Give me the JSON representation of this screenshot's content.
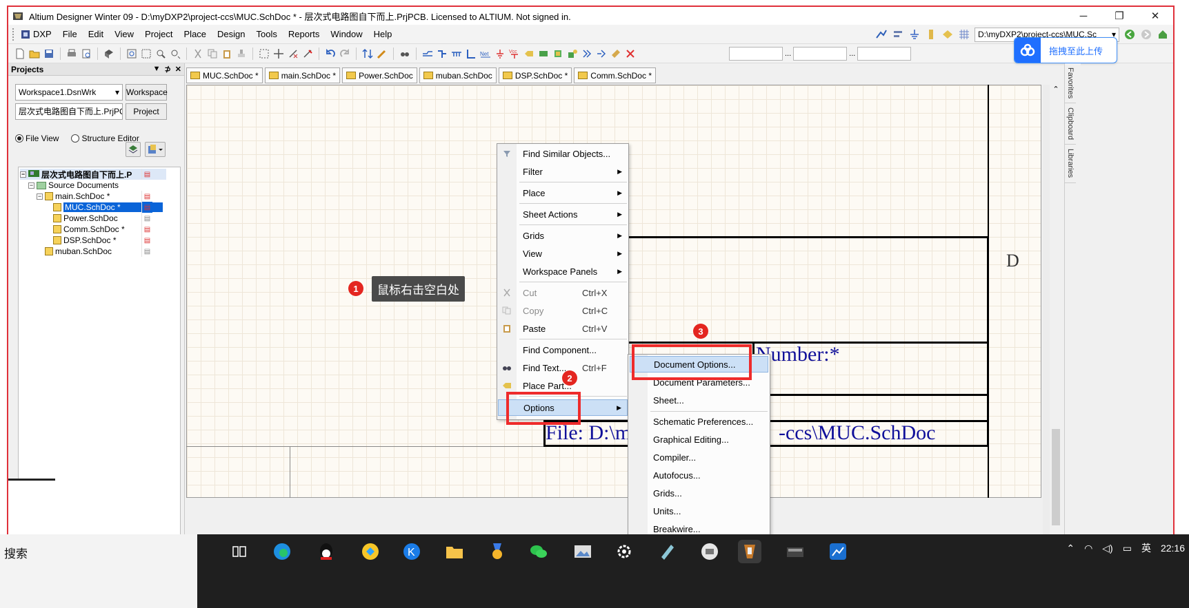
{
  "window": {
    "title": "Altium Designer Winter 09 - D:\\myDXP2\\project-ccs\\MUC.SchDoc * - 层次式电路图自下而上.PrjPCB. Licensed to ALTIUM. Not signed in.",
    "minimize": "─",
    "restore": "❐",
    "close": "✕"
  },
  "menubar": {
    "dxp": "DXP",
    "items": [
      "File",
      "Edit",
      "View",
      "Project",
      "Place",
      "Design",
      "Tools",
      "Reports",
      "Window",
      "Help"
    ],
    "path": "D:\\myDXP2\\project-ccs\\MUC.Sc",
    "path_arrow": "▾"
  },
  "toolbar": {
    "ellipsis1": "...",
    "ellipsis2": "..."
  },
  "upload_pill": {
    "label": "拖拽至此上传"
  },
  "projects_panel": {
    "title": "Projects",
    "workspace_combo": "Workspace1.DsnWrk",
    "workspace_button": "Workspace",
    "project_combo": "层次式电路图自下而上.PrjPC",
    "project_button": "Project",
    "radio_file_view": "File View",
    "radio_structure": "Structure Editor",
    "tree": [
      {
        "label": "层次式电路图自下而上.P",
        "bold": true
      },
      {
        "label": "Source Documents"
      },
      {
        "label": "main.SchDoc *"
      },
      {
        "label": "MUC.SchDoc *",
        "selected": true
      },
      {
        "label": "Power.SchDoc"
      },
      {
        "label": "Comm.SchDoc *"
      },
      {
        "label": "DSP.SchDoc *"
      },
      {
        "label": "muban.SchDoc"
      }
    ]
  },
  "doc_tabs": [
    "MUC.SchDoc *",
    "main.SchDoc *",
    "Power.SchDoc",
    "muban.SchDoc",
    "DSP.SchDoc *",
    "Comm.SchDoc *"
  ],
  "side_tabs": [
    "Favorites",
    "Clipboard",
    "Libraries"
  ],
  "sheet": {
    "zone_letter": "D",
    "number_text": "Number:*",
    "file_text_left": "File:  D:\\m",
    "file_text_right": "-ccs\\MUC.SchDoc"
  },
  "context_menu": {
    "items": [
      {
        "label": "Find Similar Objects...",
        "key": "",
        "submenu": false
      },
      {
        "label": "Filter",
        "key": "",
        "submenu": true
      },
      {
        "label": "Place",
        "key": "",
        "submenu": true
      },
      {
        "label": "Sheet Actions",
        "key": "",
        "submenu": true
      },
      {
        "label": "Grids",
        "key": "",
        "submenu": true
      },
      {
        "label": "View",
        "key": "",
        "submenu": true
      },
      {
        "label": "Workspace Panels",
        "key": "",
        "submenu": true
      },
      {
        "label": "Cut",
        "key": "Ctrl+X",
        "disabled": true
      },
      {
        "label": "Copy",
        "key": "Ctrl+C",
        "disabled": true
      },
      {
        "label": "Paste",
        "key": "Ctrl+V"
      },
      {
        "label": "Find Component...",
        "key": ""
      },
      {
        "label": "Find Text...",
        "key": "Ctrl+F"
      },
      {
        "label": "Place Part...",
        "key": ""
      },
      {
        "label": "Options",
        "key": "",
        "submenu": true,
        "highlighted": true
      }
    ],
    "arrow": "▶"
  },
  "submenu": {
    "items": [
      {
        "label": "Document Options...",
        "highlighted": true
      },
      {
        "label": "Document Parameters..."
      },
      {
        "label": "Sheet..."
      },
      {
        "label": "Schematic Preferences..."
      },
      {
        "label": "Graphical Editing..."
      },
      {
        "label": "Compiler..."
      },
      {
        "label": "Autofocus..."
      },
      {
        "label": "Grids..."
      },
      {
        "label": "Units..."
      },
      {
        "label": "Breakwire..."
      }
    ]
  },
  "annotations": {
    "step1": "1",
    "step2": "2",
    "step3": "3",
    "tooltip": "鼠标右击空白处"
  },
  "taskbar": {
    "search": "搜索",
    "ime": "英",
    "clock": "22:16"
  },
  "colors": {
    "annotation_red": "#ee2b2b",
    "selection_blue": "#0a64d8",
    "menu_highlight": "#cce0f6",
    "schematic_text": "#10109a"
  }
}
